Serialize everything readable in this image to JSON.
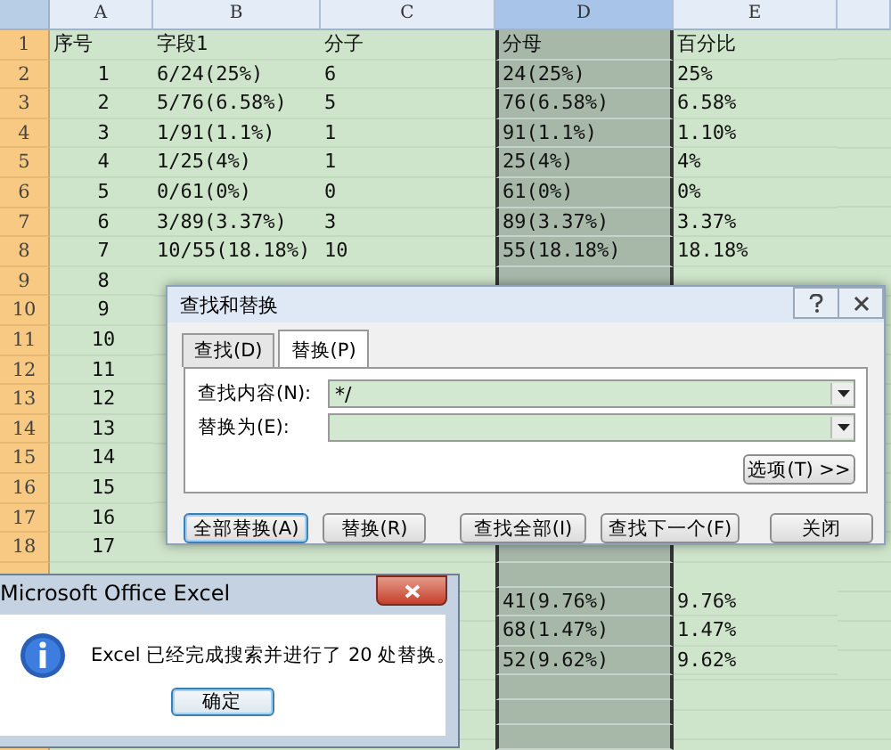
{
  "sheet": {
    "columns": [
      {
        "label": "A",
        "selected": false
      },
      {
        "label": "B",
        "selected": false
      },
      {
        "label": "C",
        "selected": false
      },
      {
        "label": "D",
        "selected": true
      },
      {
        "label": "E",
        "selected": false
      }
    ],
    "rows": [
      {
        "number": "1",
        "cells": {
          "A": "序号",
          "B": "字段1",
          "C": "分子",
          "D": "分母",
          "E": "百分比"
        }
      },
      {
        "number": "2",
        "cells": {
          "A": "1",
          "B": "6/24(25%)",
          "C": "6",
          "D": "24(25%)",
          "E": "25%"
        }
      },
      {
        "number": "3",
        "cells": {
          "A": "2",
          "B": "5/76(6.58%)",
          "C": "5",
          "D": "76(6.58%)",
          "E": "6.58%"
        }
      },
      {
        "number": "4",
        "cells": {
          "A": "3",
          "B": "1/91(1.1%)",
          "C": "1",
          "D": "91(1.1%)",
          "E": "1.10%"
        }
      },
      {
        "number": "5",
        "cells": {
          "A": "4",
          "B": "1/25(4%)",
          "C": "1",
          "D": "25(4%)",
          "E": "4%"
        }
      },
      {
        "number": "6",
        "cells": {
          "A": "5",
          "B": "0/61(0%)",
          "C": "0",
          "D": "61(0%)",
          "E": "0%"
        }
      },
      {
        "number": "7",
        "cells": {
          "A": "6",
          "B": "3/89(3.37%)",
          "C": "3",
          "D": "89(3.37%)",
          "E": "3.37%"
        }
      },
      {
        "number": "8",
        "cells": {
          "A": "7",
          "B": "10/55(18.18%)",
          "C": "10",
          "D": "55(18.18%)",
          "E": "18.18%"
        }
      },
      {
        "number": "9",
        "cells": {
          "A": "8"
        }
      },
      {
        "number": "10",
        "cells": {
          "A": "9"
        }
      },
      {
        "number": "11",
        "cells": {
          "A": "10"
        }
      },
      {
        "number": "12",
        "cells": {
          "A": "11"
        }
      },
      {
        "number": "13",
        "cells": {
          "A": "12"
        }
      },
      {
        "number": "14",
        "cells": {
          "A": "13"
        }
      },
      {
        "number": "15",
        "cells": {
          "A": "14"
        }
      },
      {
        "number": "16",
        "cells": {
          "A": "15"
        }
      },
      {
        "number": "17",
        "cells": {
          "A": "16"
        }
      },
      {
        "number": "18",
        "cells": {
          "A": "17"
        }
      },
      {
        "cells": {}
      },
      {
        "cells": {
          "D": "41(9.76%)",
          "E": "9.76%"
        }
      },
      {
        "cells": {
          "D": "68(1.47%)",
          "E": "1.47%"
        }
      },
      {
        "cells": {
          "D": "52(9.62%)",
          "E": "9.62%"
        }
      },
      {
        "cells": {}
      },
      {
        "cells": {}
      },
      {
        "cells": {}
      }
    ]
  },
  "find_replace_dialog": {
    "title": "查找和替换",
    "tabs": [
      {
        "label": "查找(D)",
        "selected": false
      },
      {
        "label": "替换(P)",
        "selected": true
      }
    ],
    "find_label": "查找内容(N):",
    "find_value": "*/",
    "replace_label": "替换为(E):",
    "options_button": "选项(T) >>",
    "buttons": [
      "全部替换(A)",
      "替换(R)",
      "查找全部(I)",
      "查找下一个(F)",
      "关闭"
    ]
  },
  "message_box": {
    "title": "Microsoft Office Excel",
    "message": "Excel 已经完成搜索并进行了 20 处替换。",
    "button": "确定"
  }
}
